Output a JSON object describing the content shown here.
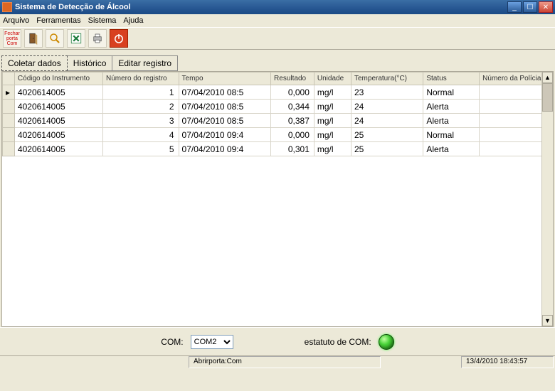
{
  "window": {
    "title": "Sistema de Detecção de Álcool"
  },
  "menu": {
    "arquivo": "Arquivo",
    "ferramentas": "Ferramentas",
    "sistema": "Sistema",
    "ajuda": "Ajuda"
  },
  "toolbar": {
    "pdf": "Fechar porta Com",
    "door": "door",
    "search": "search",
    "excel": "excel",
    "print": "print",
    "power": "power"
  },
  "tabs": {
    "coletar": "Coletar dados",
    "historico": "Histórico",
    "editar": "Editar registro"
  },
  "columns": {
    "instr": "Código do Instrumento",
    "reg": "Número do registro",
    "tempo": "Tempo",
    "res": "Resultado",
    "uni": "Unidade",
    "temp": "Temperatura(°C)",
    "status": "Status",
    "pol": "Número da Polícia"
  },
  "rows": [
    {
      "instr": "4020614005",
      "reg": "1",
      "tempo": "07/04/2010 08:5",
      "res": "0,000",
      "uni": "mg/l",
      "temp": "23",
      "status": "Normal",
      "pol": ""
    },
    {
      "instr": "4020614005",
      "reg": "2",
      "tempo": "07/04/2010 08:5",
      "res": "0,344",
      "uni": "mg/l",
      "temp": "24",
      "status": "Alerta",
      "pol": ""
    },
    {
      "instr": "4020614005",
      "reg": "3",
      "tempo": "07/04/2010 08:5",
      "res": "0,387",
      "uni": "mg/l",
      "temp": "24",
      "status": "Alerta",
      "pol": ""
    },
    {
      "instr": "4020614005",
      "reg": "4",
      "tempo": "07/04/2010 09:4",
      "res": "0,000",
      "uni": "mg/l",
      "temp": "25",
      "status": "Normal",
      "pol": ""
    },
    {
      "instr": "4020614005",
      "reg": "5",
      "tempo": "07/04/2010 09:4",
      "res": "0,301",
      "uni": "mg/l",
      "temp": "25",
      "status": "Alerta",
      "pol": ""
    }
  ],
  "com": {
    "label": "COM:",
    "selected": "COM2",
    "status_label": "estatuto de COM:"
  },
  "statusbar": {
    "port": "Abrirporta:Com",
    "time": "13/4/2010 18:43:57"
  }
}
